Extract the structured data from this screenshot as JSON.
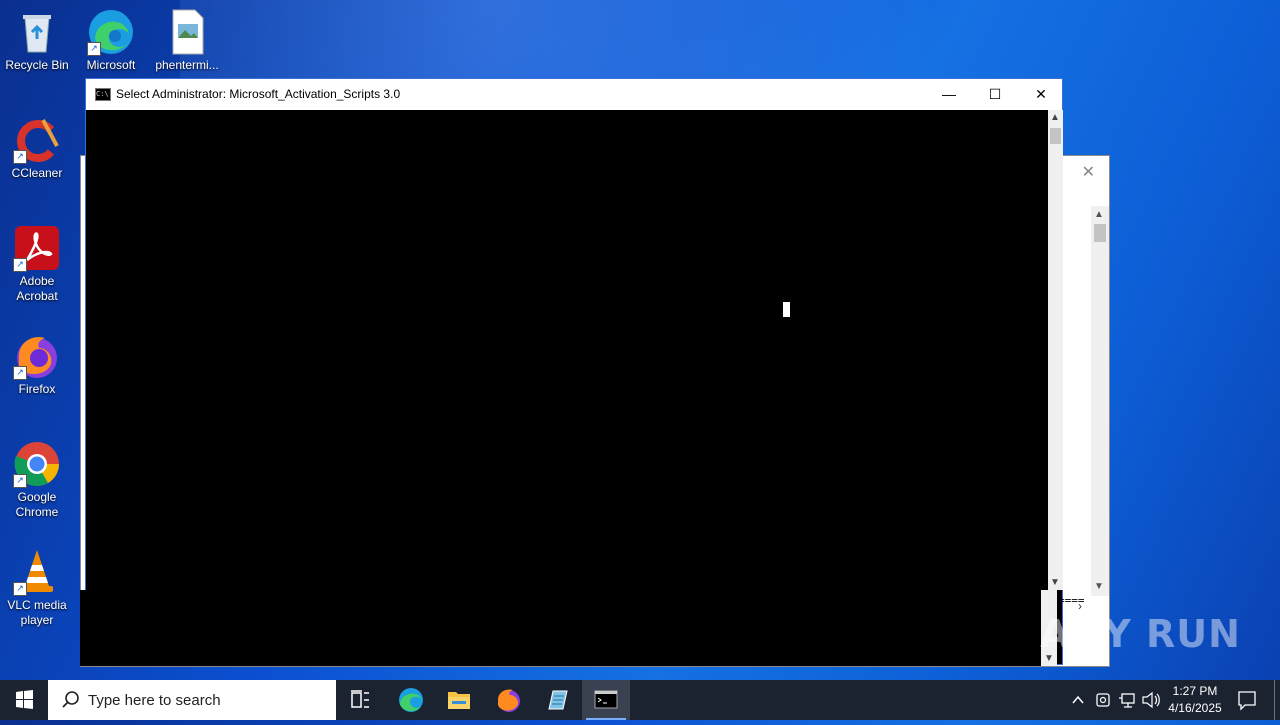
{
  "desktop": {
    "icons": [
      {
        "label": "Recycle Bin"
      },
      {
        "label": "Microsoft Edge"
      },
      {
        "label": "phentermi..."
      },
      {
        "label": "CCleaner"
      },
      {
        "label": "Adobe Acrobat"
      },
      {
        "label": "Firefox"
      },
      {
        "label": "Google Chrome"
      },
      {
        "label": "VLC media player"
      }
    ]
  },
  "console_window": {
    "title": "Select Administrator:  Microsoft_Activation_Scripts 3.0",
    "icon_text": "C:\\",
    "minimize_glyph": "—",
    "maximize_glyph": "☐",
    "close_glyph": "✕"
  },
  "background_window": {
    "close_glyph": "✕",
    "side_text": "===="
  },
  "watermark": "ANY RUN",
  "taskbar": {
    "search_placeholder": "Type here to search",
    "clock_time": "1:27 PM",
    "clock_date": "4/16/2025",
    "pinned": [
      "task-view",
      "edge",
      "file-explorer",
      "firefox",
      "notepad",
      "cmd"
    ]
  },
  "colors": {
    "desktop_bg": "#0b4fd0",
    "taskbar_bg": "#1b2230",
    "console_bg": "#000000"
  }
}
